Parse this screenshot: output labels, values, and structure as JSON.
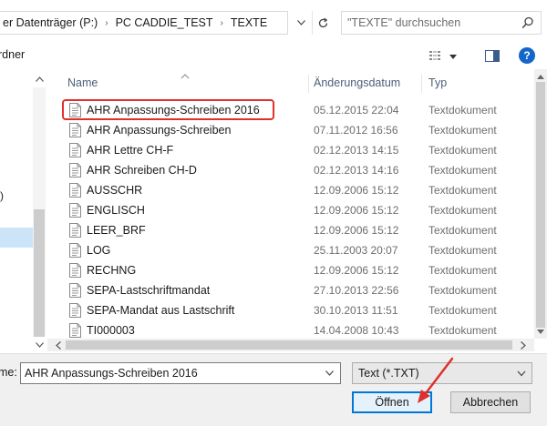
{
  "address_bar": {
    "crumbs": [
      "er Datenträger (P:)",
      "PC CADDIE_TEST",
      "TEXTE"
    ],
    "search_placeholder": "\"TEXTE\" durchsuchen"
  },
  "toolbar": {
    "new_folder_label": "rdner"
  },
  "nav": {
    "partial_item": ")"
  },
  "columns": {
    "name": "Name",
    "modified": "Änderungsdatum",
    "type": "Typ"
  },
  "files": [
    {
      "name": "AHR Anpassungs-Schreiben 2016",
      "date": "05.12.2015 22:04",
      "type": "Textdokument"
    },
    {
      "name": "AHR Anpassungs-Schreiben",
      "date": "07.11.2012 16:56",
      "type": "Textdokument"
    },
    {
      "name": "AHR Lettre CH-F",
      "date": "02.12.2013 14:15",
      "type": "Textdokument"
    },
    {
      "name": "AHR Schreiben CH-D",
      "date": "02.12.2013 14:16",
      "type": "Textdokument"
    },
    {
      "name": "AUSSCHR",
      "date": "12.09.2006 15:12",
      "type": "Textdokument"
    },
    {
      "name": "ENGLISCH",
      "date": "12.09.2006 15:12",
      "type": "Textdokument"
    },
    {
      "name": "LEER_BRF",
      "date": "12.09.2006 15:12",
      "type": "Textdokument"
    },
    {
      "name": "LOG",
      "date": "25.11.2003 20:07",
      "type": "Textdokument"
    },
    {
      "name": "RECHNG",
      "date": "12.09.2006 15:12",
      "type": "Textdokument"
    },
    {
      "name": "SEPA-Lastschriftmandat",
      "date": "27.10.2013 22:56",
      "type": "Textdokument"
    },
    {
      "name": "SEPA-Mandat aus Lastschrift",
      "date": "30.10.2013 11:51",
      "type": "Textdokument"
    },
    {
      "name": "TI000003",
      "date": "14.04.2008 10:43",
      "type": "Textdokument"
    }
  ],
  "bottom": {
    "filename_label": "me:",
    "filename_value": "AHR Anpassungs-Schreiben 2016",
    "filetype_value": "Text (*.TXT)",
    "open_label": "Öffnen",
    "cancel_label": "Abbrechen"
  },
  "colors": {
    "highlight_border": "#e0302c",
    "annotation_arrow": "#e0302c",
    "help_icon": "#1467c8",
    "primary_button_border": "#0078d7"
  },
  "icons": [
    "refresh-icon",
    "search-icon",
    "view-menu-icon",
    "preview-pane-icon",
    "help-icon",
    "text-file-icon",
    "chevron-down-icon",
    "sort-ascending-icon"
  ]
}
